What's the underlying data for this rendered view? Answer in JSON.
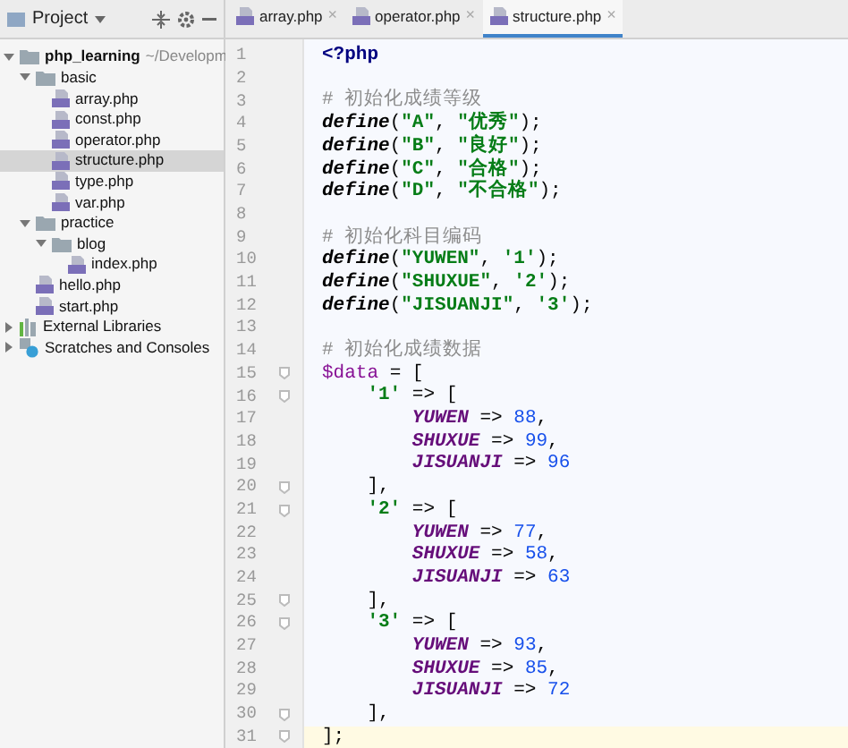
{
  "project_panel": {
    "title": "Project",
    "tree": [
      {
        "label": "php_learning",
        "hint": "~/Developm",
        "kind": "folder",
        "expanded": true,
        "selected": false,
        "children": [
          {
            "label": "basic",
            "kind": "folder",
            "expanded": true,
            "selected": false,
            "children": [
              {
                "label": "array.php",
                "kind": "php",
                "selected": false
              },
              {
                "label": "const.php",
                "kind": "php",
                "selected": false
              },
              {
                "label": "operator.php",
                "kind": "php",
                "selected": false
              },
              {
                "label": "structure.php",
                "kind": "php",
                "selected": true
              },
              {
                "label": "type.php",
                "kind": "php",
                "selected": false
              },
              {
                "label": "var.php",
                "kind": "php",
                "selected": false
              }
            ]
          },
          {
            "label": "practice",
            "kind": "folder",
            "expanded": true,
            "selected": false,
            "children": [
              {
                "label": "blog",
                "kind": "folder",
                "expanded": true,
                "selected": false,
                "children": [
                  {
                    "label": "index.php",
                    "kind": "php",
                    "selected": false
                  }
                ]
              }
            ]
          },
          {
            "label": "hello.php",
            "kind": "php",
            "selected": false
          },
          {
            "label": "start.php",
            "kind": "php",
            "selected": false
          }
        ]
      },
      {
        "label": "External Libraries",
        "kind": "library",
        "expanded": false,
        "selected": false
      },
      {
        "label": "Scratches and Consoles",
        "kind": "scratches",
        "expanded": false,
        "selected": false
      }
    ]
  },
  "tabs": [
    {
      "label": "array.php",
      "close": "×",
      "selected": false
    },
    {
      "label": "operator.php",
      "close": "×",
      "selected": false
    },
    {
      "label": "structure.php",
      "close": "×",
      "selected": true
    }
  ],
  "editor": {
    "lines": [
      {
        "number": "1",
        "tokens": [
          {
            "kind": "keyword",
            "text": "<?php"
          }
        ]
      },
      {
        "number": "2"
      },
      {
        "number": "3",
        "tokens": [
          {
            "kind": "comment",
            "text": "# 初始化成绩等级"
          }
        ]
      },
      {
        "number": "4",
        "tokens": [
          {
            "kind": "func",
            "text": "define"
          },
          {
            "kind": "plain",
            "text": "("
          },
          {
            "kind": "string",
            "text": "\"A\""
          },
          {
            "kind": "plain",
            "text": ", "
          },
          {
            "kind": "string",
            "text": "\"优秀\""
          },
          {
            "kind": "plain",
            "text": ");"
          }
        ]
      },
      {
        "number": "5",
        "tokens": [
          {
            "kind": "func",
            "text": "define"
          },
          {
            "kind": "plain",
            "text": "("
          },
          {
            "kind": "string",
            "text": "\"B\""
          },
          {
            "kind": "plain",
            "text": ", "
          },
          {
            "kind": "string",
            "text": "\"良好\""
          },
          {
            "kind": "plain",
            "text": ");"
          }
        ]
      },
      {
        "number": "6",
        "tokens": [
          {
            "kind": "func",
            "text": "define"
          },
          {
            "kind": "plain",
            "text": "("
          },
          {
            "kind": "string",
            "text": "\"C\""
          },
          {
            "kind": "plain",
            "text": ", "
          },
          {
            "kind": "string",
            "text": "\"合格\""
          },
          {
            "kind": "plain",
            "text": ");"
          }
        ]
      },
      {
        "number": "7",
        "tokens": [
          {
            "kind": "func",
            "text": "define"
          },
          {
            "kind": "plain",
            "text": "("
          },
          {
            "kind": "string",
            "text": "\"D\""
          },
          {
            "kind": "plain",
            "text": ", "
          },
          {
            "kind": "string",
            "text": "\"不合格\""
          },
          {
            "kind": "plain",
            "text": ");"
          }
        ]
      },
      {
        "number": "8"
      },
      {
        "number": "9",
        "tokens": [
          {
            "kind": "comment",
            "text": "# 初始化科目编码"
          }
        ]
      },
      {
        "number": "10",
        "tokens": [
          {
            "kind": "func",
            "text": "define"
          },
          {
            "kind": "plain",
            "text": "("
          },
          {
            "kind": "string",
            "text": "\"YUWEN\""
          },
          {
            "kind": "plain",
            "text": ", "
          },
          {
            "kind": "string",
            "text": "'1'"
          },
          {
            "kind": "plain",
            "text": ");"
          }
        ]
      },
      {
        "number": "11",
        "tokens": [
          {
            "kind": "func",
            "text": "define"
          },
          {
            "kind": "plain",
            "text": "("
          },
          {
            "kind": "string",
            "text": "\"SHUXUE\""
          },
          {
            "kind": "plain",
            "text": ", "
          },
          {
            "kind": "string",
            "text": "'2'"
          },
          {
            "kind": "plain",
            "text": ");"
          }
        ]
      },
      {
        "number": "12",
        "tokens": [
          {
            "kind": "func",
            "text": "define"
          },
          {
            "kind": "plain",
            "text": "("
          },
          {
            "kind": "string",
            "text": "\"JISUANJI\""
          },
          {
            "kind": "plain",
            "text": ", "
          },
          {
            "kind": "string",
            "text": "'3'"
          },
          {
            "kind": "plain",
            "text": ");"
          }
        ]
      },
      {
        "number": "13"
      },
      {
        "number": "14",
        "tokens": [
          {
            "kind": "comment",
            "text": "# 初始化成绩数据"
          }
        ]
      },
      {
        "number": "15",
        "fold": true,
        "tokens": [
          {
            "kind": "var",
            "text": "$data"
          },
          {
            "kind": "plain",
            "text": " = ["
          }
        ]
      },
      {
        "number": "16",
        "fold": true,
        "tokens": [
          {
            "kind": "string",
            "text": "    '1'"
          },
          {
            "kind": "plain",
            "text": " => ["
          }
        ]
      },
      {
        "number": "17",
        "tokens": [
          {
            "kind": "const",
            "text": "        YUWEN"
          },
          {
            "kind": "plain",
            "text": " => "
          },
          {
            "kind": "number",
            "text": "88"
          },
          {
            "kind": "plain",
            "text": ","
          }
        ]
      },
      {
        "number": "18",
        "tokens": [
          {
            "kind": "const",
            "text": "        SHUXUE"
          },
          {
            "kind": "plain",
            "text": " => "
          },
          {
            "kind": "number",
            "text": "99"
          },
          {
            "kind": "plain",
            "text": ","
          }
        ]
      },
      {
        "number": "19",
        "tokens": [
          {
            "kind": "const",
            "text": "        JISUANJI"
          },
          {
            "kind": "plain",
            "text": " => "
          },
          {
            "kind": "number",
            "text": "96"
          }
        ]
      },
      {
        "number": "20",
        "fold": true,
        "tokens": [
          {
            "kind": "plain",
            "text": "    ],"
          }
        ]
      },
      {
        "number": "21",
        "fold": true,
        "tokens": [
          {
            "kind": "string",
            "text": "    '2'"
          },
          {
            "kind": "plain",
            "text": " => ["
          }
        ]
      },
      {
        "number": "22",
        "tokens": [
          {
            "kind": "const",
            "text": "        YUWEN"
          },
          {
            "kind": "plain",
            "text": " => "
          },
          {
            "kind": "number",
            "text": "77"
          },
          {
            "kind": "plain",
            "text": ","
          }
        ]
      },
      {
        "number": "23",
        "tokens": [
          {
            "kind": "const",
            "text": "        SHUXUE"
          },
          {
            "kind": "plain",
            "text": " => "
          },
          {
            "kind": "number",
            "text": "58"
          },
          {
            "kind": "plain",
            "text": ","
          }
        ]
      },
      {
        "number": "24",
        "tokens": [
          {
            "kind": "const",
            "text": "        JISUANJI"
          },
          {
            "kind": "plain",
            "text": " => "
          },
          {
            "kind": "number",
            "text": "63"
          }
        ]
      },
      {
        "number": "25",
        "fold": true,
        "tokens": [
          {
            "kind": "plain",
            "text": "    ],"
          }
        ]
      },
      {
        "number": "26",
        "fold": true,
        "tokens": [
          {
            "kind": "string",
            "text": "    '3'"
          },
          {
            "kind": "plain",
            "text": " => ["
          }
        ]
      },
      {
        "number": "27",
        "tokens": [
          {
            "kind": "const",
            "text": "        YUWEN"
          },
          {
            "kind": "plain",
            "text": " => "
          },
          {
            "kind": "number",
            "text": "93"
          },
          {
            "kind": "plain",
            "text": ","
          }
        ]
      },
      {
        "number": "28",
        "tokens": [
          {
            "kind": "const",
            "text": "        SHUXUE"
          },
          {
            "kind": "plain",
            "text": " => "
          },
          {
            "kind": "number",
            "text": "85"
          },
          {
            "kind": "plain",
            "text": ","
          }
        ]
      },
      {
        "number": "29",
        "tokens": [
          {
            "kind": "const",
            "text": "        JISUANJI"
          },
          {
            "kind": "plain",
            "text": " => "
          },
          {
            "kind": "number",
            "text": "72"
          }
        ]
      },
      {
        "number": "30",
        "fold": true,
        "tokens": [
          {
            "kind": "plain",
            "text": "    ],"
          }
        ]
      },
      {
        "number": "31",
        "fold": true,
        "current": true,
        "tokens": [
          {
            "kind": "plain",
            "text": "];"
          }
        ]
      }
    ]
  }
}
